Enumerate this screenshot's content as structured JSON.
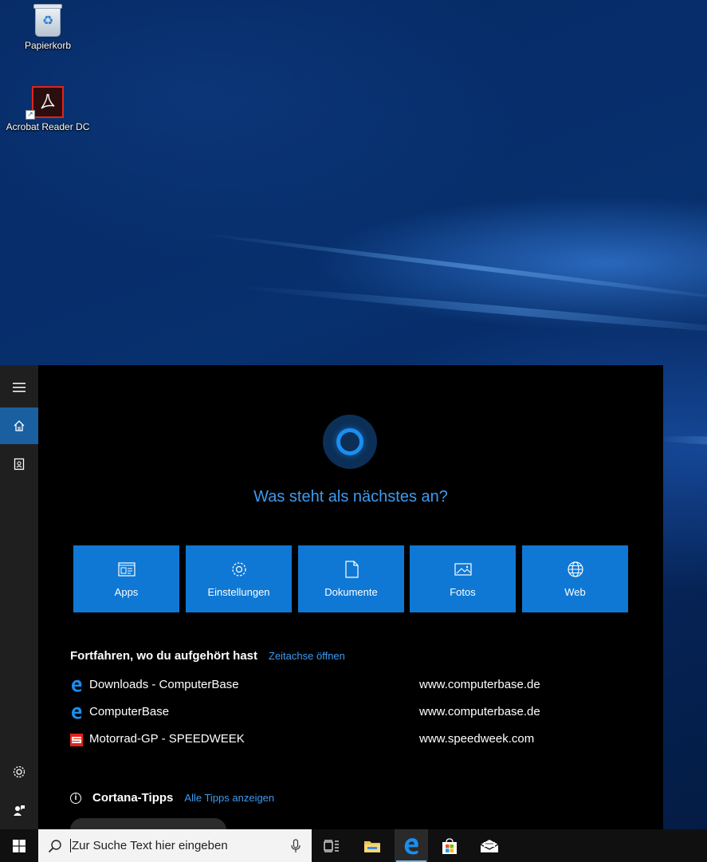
{
  "desktop": {
    "icons": [
      {
        "label": "Papierkorb"
      },
      {
        "label": "Acrobat Reader DC"
      }
    ]
  },
  "rail": {
    "items": [
      "hamburger-menu",
      "home",
      "notebook",
      "settings",
      "feedback"
    ]
  },
  "cortana": {
    "question": "Was steht als nächstes an?",
    "tiles": [
      {
        "label": "Apps",
        "icon": "apps-icon"
      },
      {
        "label": "Einstellungen",
        "icon": "settings-gear-icon"
      },
      {
        "label": "Dokumente",
        "icon": "document-icon"
      },
      {
        "label": "Fotos",
        "icon": "photo-icon"
      },
      {
        "label": "Web",
        "icon": "globe-icon"
      }
    ],
    "continue": {
      "heading": "Fortfahren, wo du aufgehört hast",
      "link": "Zeitachse öffnen",
      "items": [
        {
          "title": "Downloads - ComputerBase",
          "url": "www.computerbase.de",
          "icon": "edge-icon"
        },
        {
          "title": "ComputerBase",
          "url": "www.computerbase.de",
          "icon": "edge-icon"
        },
        {
          "title": "Motorrad-GP - SPEEDWEEK",
          "url": "www.speedweek.com",
          "icon": "speedweek-icon"
        }
      ]
    },
    "tips": {
      "heading": "Cortana-Tipps",
      "link": "Alle Tipps anzeigen"
    }
  },
  "taskbar": {
    "search_placeholder": "Zur Suche Text hier eingeben",
    "apps": [
      "task-view",
      "file-explorer",
      "edge",
      "store",
      "mail"
    ]
  },
  "colors": {
    "accent": "#0f78d4",
    "link": "#3c9bf0",
    "panel": "#000000",
    "rail": "#1f1f1f"
  }
}
